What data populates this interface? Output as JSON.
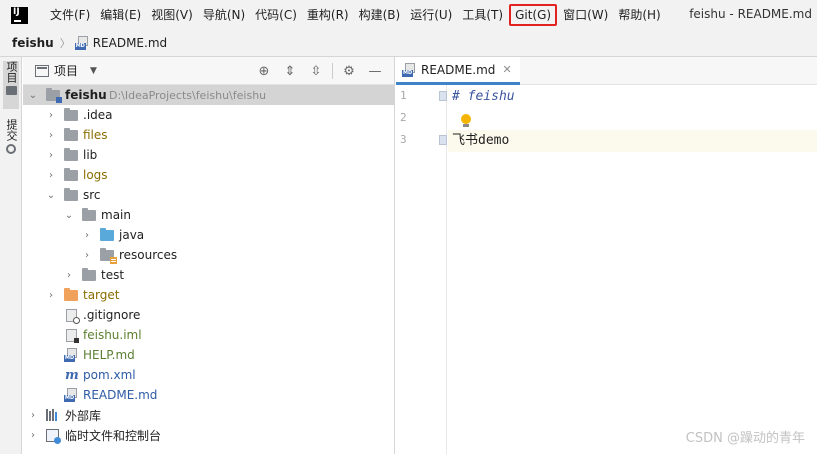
{
  "menubar": {
    "logo": "IJ",
    "items": [
      {
        "label": "文件(F)"
      },
      {
        "label": "编辑(E)"
      },
      {
        "label": "视图(V)"
      },
      {
        "label": "导航(N)"
      },
      {
        "label": "代码(C)"
      },
      {
        "label": "重构(R)"
      },
      {
        "label": "构建(B)"
      },
      {
        "label": "运行(U)"
      },
      {
        "label": "工具(T)"
      },
      {
        "label": "Git(G)",
        "highlighted": true
      },
      {
        "label": "窗口(W)"
      },
      {
        "label": "帮助(H)"
      }
    ],
    "window_title": "feishu - README.md"
  },
  "breadcrumb": {
    "root": "feishu",
    "file": "README.md"
  },
  "stripe": {
    "project_label": "项目",
    "commit_label": "提交"
  },
  "project_panel": {
    "title": "项目",
    "tree": [
      {
        "label": "feishu",
        "extra": "D:\\IdeaProjects\\feishu\\feishu",
        "icon": "module-folder-icon",
        "expanded": true,
        "selected": true
      },
      {
        "label": ".idea",
        "icon": "folder-icon",
        "color": "default"
      },
      {
        "label": "files",
        "icon": "folder-icon",
        "color": "yellow"
      },
      {
        "label": "lib",
        "icon": "folder-icon",
        "color": "default"
      },
      {
        "label": "logs",
        "icon": "folder-icon",
        "color": "yellow"
      },
      {
        "label": "src",
        "icon": "folder-icon",
        "color": "default",
        "expanded": true
      },
      {
        "label": "main",
        "icon": "folder-icon",
        "color": "default",
        "expanded": true
      },
      {
        "label": "java",
        "icon": "source-folder-icon",
        "color": "default"
      },
      {
        "label": "resources",
        "icon": "resources-folder-icon",
        "color": "default"
      },
      {
        "label": "test",
        "icon": "folder-icon",
        "color": "default"
      },
      {
        "label": "target",
        "icon": "excluded-folder-icon",
        "color": "yellow"
      },
      {
        "label": ".gitignore",
        "icon": "gitignore-file-icon",
        "color": "default"
      },
      {
        "label": "feishu.iml",
        "icon": "iml-file-icon",
        "color": "green"
      },
      {
        "label": "HELP.md",
        "icon": "markdown-file-icon",
        "color": "green"
      },
      {
        "label": "pom.xml",
        "icon": "maven-file-icon",
        "color": "blue"
      },
      {
        "label": "README.md",
        "icon": "markdown-file-icon",
        "color": "blue"
      },
      {
        "label": "外部库",
        "icon": "library-icon",
        "color": "default"
      },
      {
        "label": "临时文件和控制台",
        "icon": "scratch-icon",
        "color": "default"
      }
    ]
  },
  "editor": {
    "tab_label": "README.md",
    "lines": [
      {
        "number": "1",
        "text": "# feishu",
        "kind": "heading"
      },
      {
        "number": "2",
        "text": "",
        "kind": "blank"
      },
      {
        "number": "3",
        "text": "飞书demo",
        "kind": "text"
      }
    ]
  },
  "watermark": "CSDN @躁动的青年",
  "colors": {
    "highlight_box": "#e32121",
    "accent": "#4083c9",
    "selection": "#d4d4d4"
  }
}
